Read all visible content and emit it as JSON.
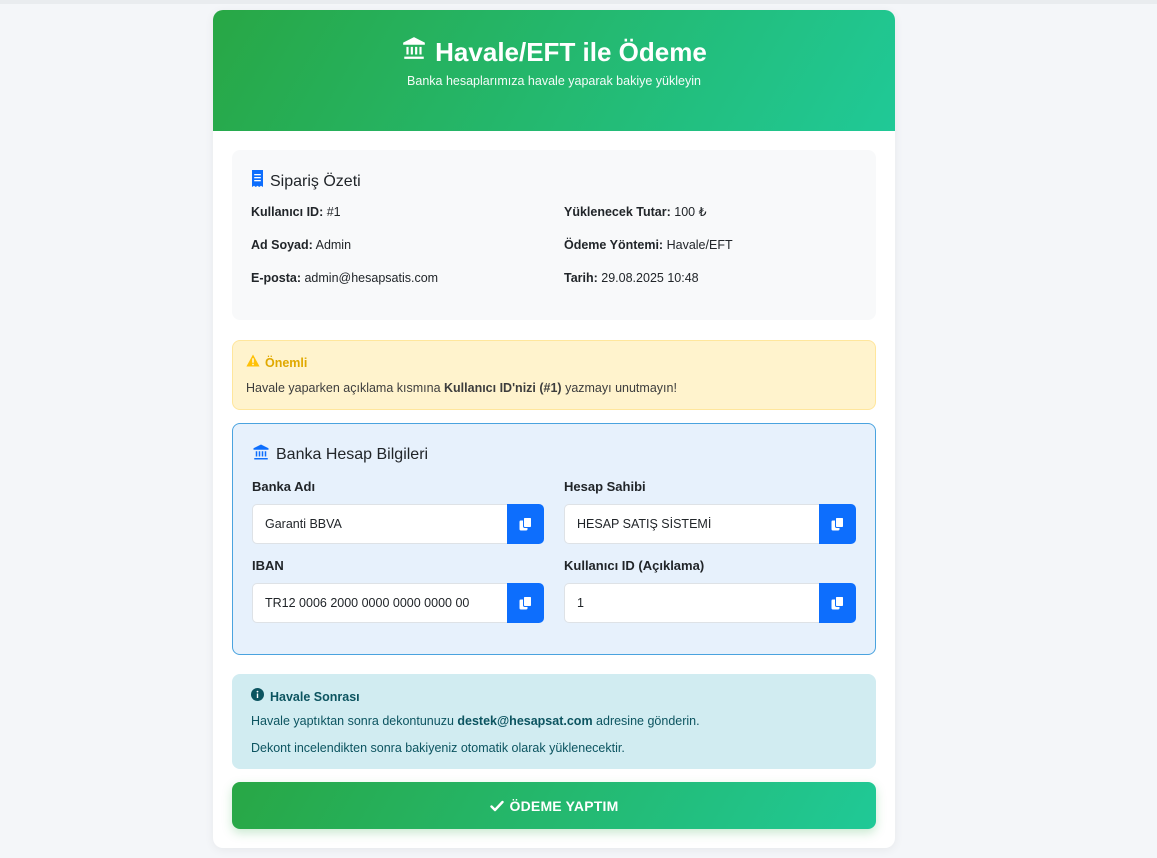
{
  "header": {
    "icon": "bank-icon",
    "title": "Havale/EFT ile Ödeme",
    "subtitle": "Banka hesaplarımıza havale yaparak bakiye yükleyin"
  },
  "summary": {
    "icon": "receipt-icon",
    "title": "Sipariş Özeti",
    "user_id_label": "Kullanıcı ID:",
    "user_id_value": "#1",
    "amount_label": "Yüklenecek Tutar:",
    "amount_value": "100 ₺",
    "name_label": "Ad Soyad:",
    "name_value": "Admin",
    "method_label": "Ödeme Yöntemi:",
    "method_value": "Havale/EFT",
    "email_label": "E-posta:",
    "email_value": "admin@hesapsatis.com",
    "date_label": "Tarih:",
    "date_value": "29.08.2025 10:48"
  },
  "warning": {
    "icon": "warning-triangle-icon",
    "title": "Önemli",
    "text_before": "Havale yaparken açıklama kısmına ",
    "text_bold": "Kullanıcı ID'nizi (#1)",
    "text_after": " yazmayı unutmayın!"
  },
  "bank": {
    "icon": "bank-icon",
    "title": "Banka Hesap Bilgileri",
    "fields": [
      {
        "label": "Banka Adı",
        "value": "Garanti BBVA"
      },
      {
        "label": "Hesap Sahibi",
        "value": "HESAP SATIŞ SİSTEMİ"
      },
      {
        "label": "IBAN",
        "value": "TR12 0006 2000 0000 0000 0000 00"
      },
      {
        "label": "Kullanıcı ID (Açıklama)",
        "value": "1"
      }
    ]
  },
  "after": {
    "icon": "info-circle-icon",
    "title": "Havale Sonrası",
    "line1_before": "Havale yaptıktan sonra dekontunuzu ",
    "line1_email": "destek@hesapsat.com",
    "line1_after": " adresine gönderin.",
    "line2": "Dekont incelendikten sonra bakiyeniz otomatik olarak yüklenecektir."
  },
  "submit": {
    "icon": "check-icon",
    "label": "ÖDEME YAPTIM"
  },
  "colors": {
    "header_gradient_start": "#28a745",
    "header_gradient_end": "#20c997",
    "copy_button": "#0d6efd",
    "warning_bg": "#fff3cd",
    "bank_bg": "#e7f1fc",
    "info_bg": "#d1ecf1"
  }
}
